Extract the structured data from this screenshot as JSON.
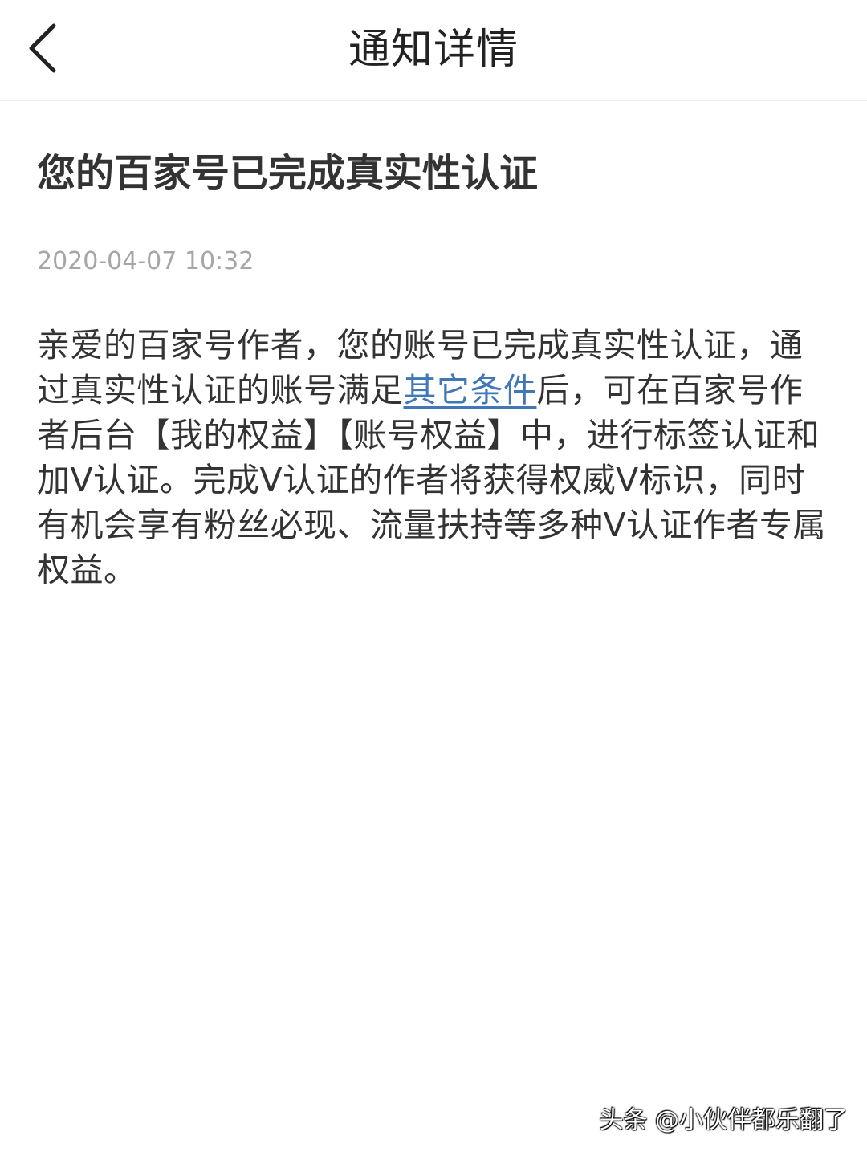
{
  "navbar": {
    "back_icon": "chevron-left-icon",
    "title": "通知详情"
  },
  "notification": {
    "title": "您的百家号已完成真实性认证",
    "time": "2020-04-07 10:32",
    "body_before_link": "亲爱的百家号作者，您的账号已完成真实性认证，通过真实性认证的账号满足",
    "link_text": "其它条件",
    "body_after_link": "后，可在百家号作者后台【我的权益】【账号权益】中，进行标签认证和加V认证。完成V认证的作者将获得权威V标识，同时有机会享有粉丝必现、流量扶持等多种V认证作者专属权益。",
    "link_color": "#3f77b7"
  },
  "watermark": {
    "text": "头条 @小伙伴都乐翻了"
  }
}
